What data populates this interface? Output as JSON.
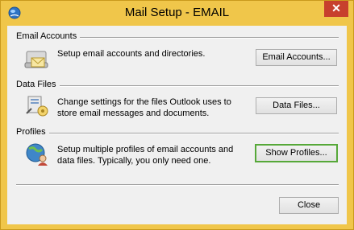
{
  "window": {
    "title": "Mail Setup - EMAIL",
    "close_glyph": "✕"
  },
  "sections": {
    "email_accounts": {
      "title": "Email Accounts",
      "description": "Setup email accounts and directories.",
      "button": "Email Accounts...",
      "icon": "email-accounts-icon"
    },
    "data_files": {
      "title": "Data Files",
      "description": "Change settings for the files Outlook uses to store email messages and documents.",
      "button": "Data Files...",
      "icon": "data-files-icon"
    },
    "profiles": {
      "title": "Profiles",
      "description": "Setup multiple profiles of email accounts and data files. Typically, you only need one.",
      "button": "Show Profiles...",
      "icon": "profiles-icon"
    }
  },
  "footer": {
    "close_button": "Close"
  },
  "colors": {
    "titlebar": "#f0c64a",
    "close_x_bg": "#c7402d",
    "focus_border": "#56a839"
  }
}
